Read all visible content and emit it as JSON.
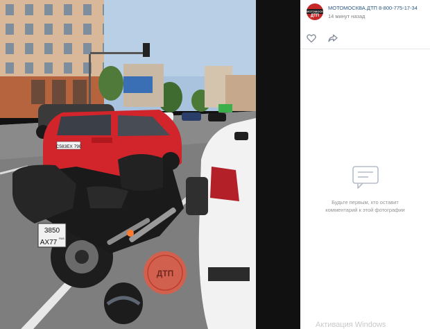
{
  "photo": {
    "description_icon": "accident-photo",
    "plate_car": "С583ЕХ 790",
    "plate_moto_line1": "3850",
    "plate_moto_line2": "АХ77",
    "plate_moto_region": "RUS",
    "stamp_label": "ДТП"
  },
  "post": {
    "author": "МОТОМОСКВА.ДТП 8-800-775-17-34",
    "avatar_label_top": "МОТОМОСКВА",
    "avatar_label": "ДТП",
    "timestamp": "14 минут назад"
  },
  "actions": {
    "like_icon": "heart-outline-icon",
    "share_icon": "share-arrow-icon"
  },
  "comments": {
    "empty_line1": "Будьте первым, кто оставит",
    "empty_line2": "комментарий к этой фотографии"
  },
  "system": {
    "watermark": "Активация Windows"
  },
  "colors": {
    "link": "#2a5885",
    "muted": "#828282",
    "backdrop": "#111111"
  }
}
